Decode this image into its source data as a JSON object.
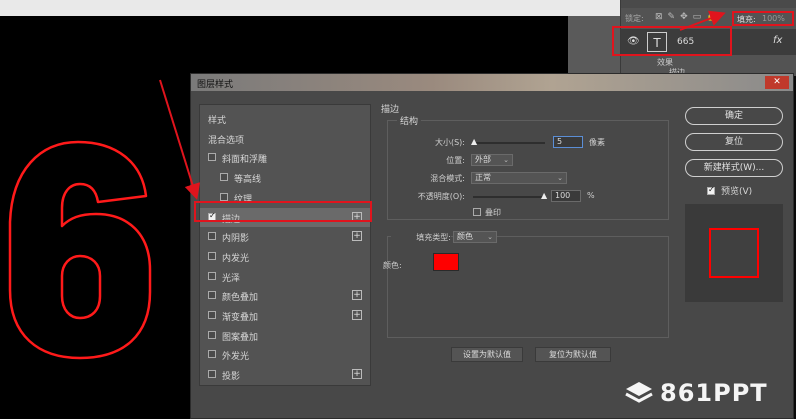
{
  "layers_panel": {
    "lock_label": "锁定:",
    "lock_icons": [
      "⊠",
      "✎",
      "✥",
      "▭",
      "🔒"
    ],
    "fill_label": "填充:",
    "fill_value": "100%",
    "layer_name": "665",
    "fx_label": "fx",
    "effects_label": "效果",
    "stroke_effect": "描边"
  },
  "dialog": {
    "title": "图层样式",
    "close_label": "✕",
    "style_list": [
      {
        "label": "样式",
        "checkbox": false,
        "checked": false,
        "plus": false,
        "indent": 0
      },
      {
        "label": "混合选项",
        "checkbox": false,
        "checked": false,
        "plus": false,
        "indent": 0
      },
      {
        "label": "斜面和浮雕",
        "checkbox": true,
        "checked": false,
        "plus": false,
        "indent": 0
      },
      {
        "label": "等高线",
        "checkbox": true,
        "checked": false,
        "plus": false,
        "indent": 1
      },
      {
        "label": "纹理",
        "checkbox": true,
        "checked": false,
        "plus": false,
        "indent": 1
      },
      {
        "label": "描边",
        "checkbox": true,
        "checked": true,
        "plus": true,
        "indent": 0,
        "selected": true
      },
      {
        "label": "内阴影",
        "checkbox": true,
        "checked": false,
        "plus": true,
        "indent": 0
      },
      {
        "label": "内发光",
        "checkbox": true,
        "checked": false,
        "plus": false,
        "indent": 0
      },
      {
        "label": "光泽",
        "checkbox": true,
        "checked": false,
        "plus": false,
        "indent": 0
      },
      {
        "label": "颜色叠加",
        "checkbox": true,
        "checked": false,
        "plus": true,
        "indent": 0
      },
      {
        "label": "渐变叠加",
        "checkbox": true,
        "checked": false,
        "plus": true,
        "indent": 0
      },
      {
        "label": "图案叠加",
        "checkbox": true,
        "checked": false,
        "plus": false,
        "indent": 0
      },
      {
        "label": "外发光",
        "checkbox": true,
        "checked": false,
        "plus": false,
        "indent": 0
      },
      {
        "label": "投影",
        "checkbox": true,
        "checked": false,
        "plus": true,
        "indent": 0
      }
    ],
    "stroke": {
      "section_title": "描边",
      "structure_title": "结构",
      "size_label": "大小(S):",
      "size_value": "5",
      "size_unit": "像素",
      "position_label": "位置:",
      "position_value": "外部",
      "blend_label": "混合模式:",
      "blend_value": "正常",
      "opacity_label": "不透明度(O):",
      "opacity_value": "100",
      "opacity_unit": "%",
      "emboss_label": "叠印",
      "fill_type_label": "填充类型:",
      "fill_type_value": "颜色",
      "color_label": "颜色:",
      "color_hex": "#ff0000",
      "set_default": "设置为默认值",
      "reset_default": "复位为默认值"
    },
    "buttons": {
      "ok": "确定",
      "reset": "复位",
      "new_style": "新建样式(W)...",
      "preview_label": "预览(V)"
    }
  },
  "canvas": {
    "digit": "6",
    "stroke_color": "#ff1a1a"
  },
  "watermark": "861PPT"
}
